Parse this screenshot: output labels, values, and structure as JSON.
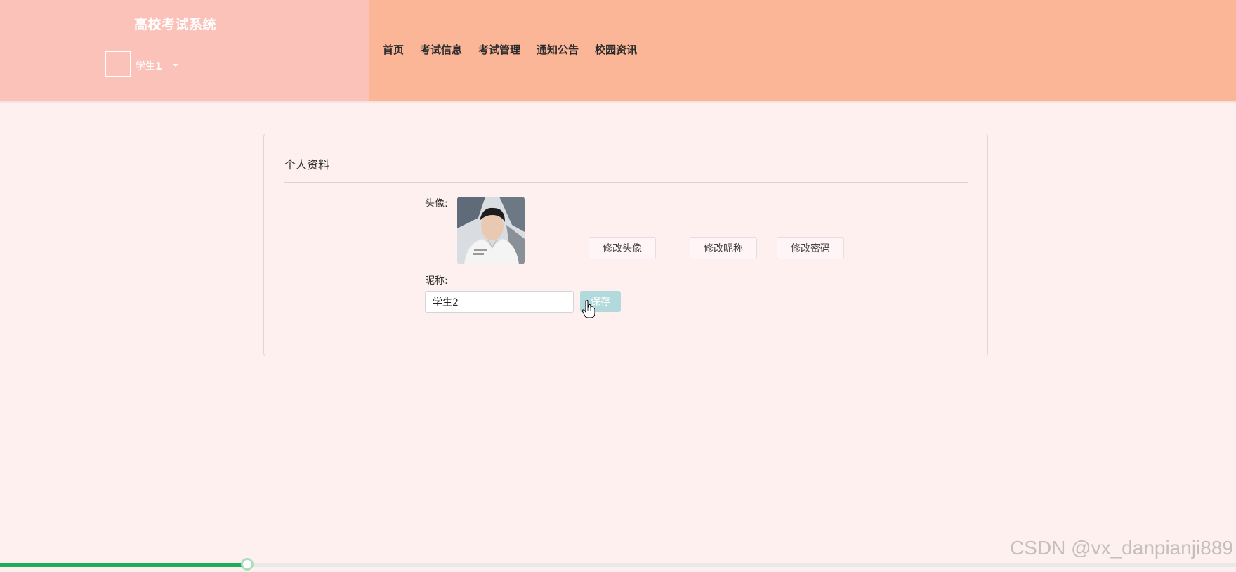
{
  "header": {
    "site_title": "高校考试系统",
    "user_name": "学生1",
    "nav": [
      "首页",
      "考试信息",
      "考试管理",
      "通知公告",
      "校园资讯"
    ],
    "colors": {
      "left_bg": "#fac2b8",
      "right_bg": "#fbb698"
    }
  },
  "profile": {
    "card_title": "个人资料",
    "avatar_label": "头像:",
    "buttons": {
      "change_avatar": "修改头像",
      "change_nickname": "修改昵称",
      "change_password": "修改密码"
    },
    "nickname_label": "昵称:",
    "nickname_value": "学生2",
    "save_label": "保存"
  },
  "video_progress": {
    "fraction": 0.2
  },
  "watermark": "CSDN @vx_danpianji889",
  "icons": [
    "caret-down-icon",
    "hand-pointer-cursor-icon"
  ]
}
